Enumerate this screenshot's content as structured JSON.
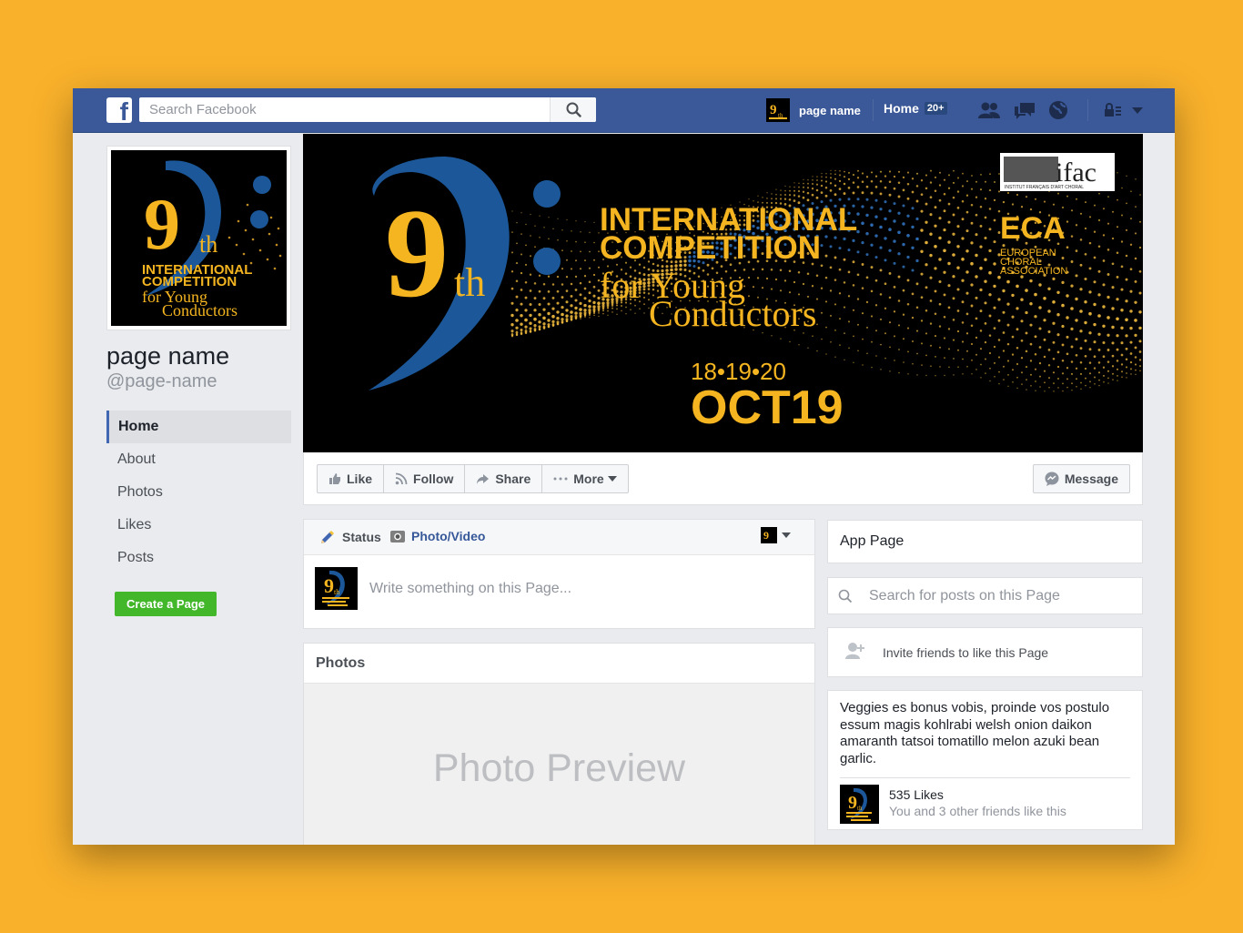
{
  "topbar": {
    "logo_letter": "f",
    "search_placeholder": "Search Facebook",
    "profile_name": "page name",
    "home_label": "Home",
    "home_badge": "20+"
  },
  "profile": {
    "name": "page name",
    "handle": "@page-name"
  },
  "left_nav": {
    "items": [
      {
        "label": "Home",
        "active": true
      },
      {
        "label": "About"
      },
      {
        "label": "Photos"
      },
      {
        "label": "Likes"
      },
      {
        "label": "Posts"
      }
    ],
    "create_page": "Create a Page"
  },
  "cover": {
    "numeral": "9",
    "ordinal": "th",
    "line1": "INTERNATIONAL",
    "line2": "COMPETITION",
    "line3": "for Young",
    "line4": "Conductors",
    "dates": "18•19•20",
    "month_year": "OCT19",
    "logo_ifac": "ifac",
    "logo_ifac_sub": "INSTITUT FRANÇAIS D'ART CHORAL",
    "logo_eca": "ECA",
    "eca_line1": "EUROPEAN",
    "eca_line2": "CHORAL",
    "eca_line3": "ASSOCIATION"
  },
  "profile_art": {
    "numeral": "9",
    "ordinal": "th",
    "line1": "INTERNATIONAL",
    "line2": "COMPETITION",
    "line3": "for Young",
    "line4": "Conductors"
  },
  "actions": {
    "like": "Like",
    "follow": "Follow",
    "share": "Share",
    "more": "More",
    "message": "Message"
  },
  "composer": {
    "status_tab": "Status",
    "photo_tab": "Photo/Video",
    "placeholder": "Write something on this Page..."
  },
  "photos": {
    "title": "Photos",
    "preview": "Photo Preview"
  },
  "sidebar": {
    "app_page": "App Page",
    "search_placeholder": "Search for posts on this Page",
    "invite": "Invite friends to like this Page",
    "about": "Veggies es bonus vobis, proinde vos postulo essum magis kohlrabi welsh onion daikon amaranth tatsoi tomatillo melon azuki bean garlic.",
    "likes_count": "535 Likes",
    "likes_friends": "You and 3 other friends like this"
  },
  "colors": {
    "facebook_blue": "#3b5998",
    "brand_gold": "#f5b520",
    "brand_blue": "#1c5899",
    "green": "#42b72a"
  }
}
